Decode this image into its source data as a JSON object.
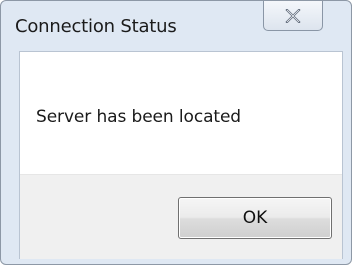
{
  "window": {
    "title": "Connection Status",
    "close_icon": "close-icon"
  },
  "dialog": {
    "message": "Server has been located",
    "ok_label": "OK"
  },
  "colors": {
    "frame": "#dfe8f3",
    "border": "#8d98a6",
    "button_bar": "#f0f0f0"
  }
}
